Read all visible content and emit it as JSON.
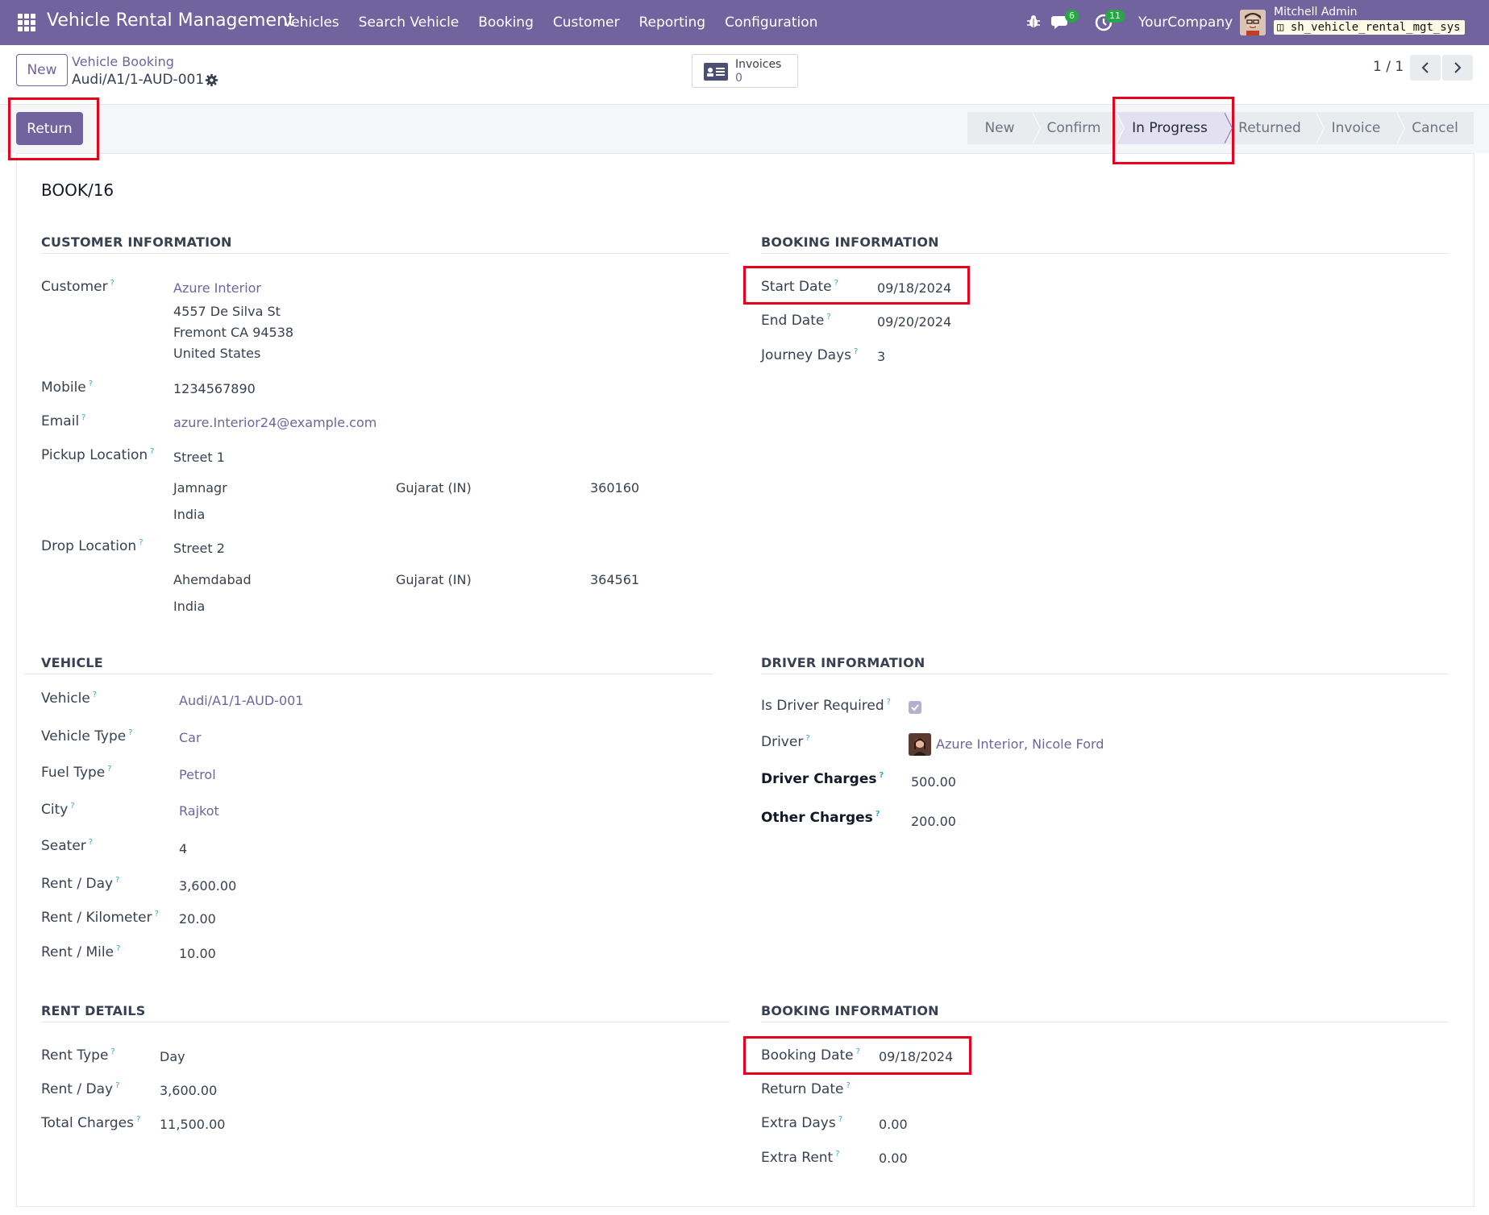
{
  "navbar": {
    "brand": "Vehicle Rental Management",
    "menu": [
      "Vehicles",
      "Search Vehicle",
      "Booking",
      "Customer",
      "Reporting",
      "Configuration"
    ],
    "chat_count": "6",
    "activity_count": "11",
    "company": "YourCompany",
    "user_name": "Mitchell Admin",
    "database": "sh_vehicle_rental_mgt_sys"
  },
  "control": {
    "new_label": "New",
    "breadcrumb_parent": "Vehicle Booking",
    "breadcrumb_current": "Audi/A1/1-AUD-001",
    "smart_invoices_label": "Invoices",
    "smart_invoices_count": "0",
    "pager": "1 / 1"
  },
  "statusbar": {
    "return_label": "Return",
    "stages": [
      "New",
      "Confirm",
      "In Progress",
      "Returned",
      "Invoice",
      "Cancel"
    ],
    "active_stage": "In Progress"
  },
  "record": {
    "reference": "BOOK/16"
  },
  "customer_info": {
    "title": "CUSTOMER INFORMATION",
    "customer_label": "Customer",
    "customer_name": "Azure Interior",
    "address_line1": "4557 De Silva St",
    "address_line2": "Fremont CA 94538",
    "address_line3": "United States",
    "mobile_label": "Mobile",
    "mobile": "1234567890",
    "email_label": "Email",
    "email": "azure.Interior24@example.com",
    "pickup_label": "Pickup Location",
    "pickup_street": "Street 1",
    "pickup_city": "Jamnagr",
    "pickup_state": "Gujarat (IN)",
    "pickup_zip": "360160",
    "pickup_country": "India",
    "drop_label": "Drop Location",
    "drop_street": "Street 2",
    "drop_city": "Ahemdabad",
    "drop_state": "Gujarat (IN)",
    "drop_zip": "364561",
    "drop_country": "India"
  },
  "booking_info": {
    "title": "BOOKING INFORMATION",
    "start_label": "Start Date",
    "start_date": "09/18/2024",
    "end_label": "End Date",
    "end_date": "09/20/2024",
    "days_label": "Journey Days",
    "days": "3"
  },
  "vehicle": {
    "title": "VEHICLE",
    "vehicle_label": "Vehicle",
    "vehicle": "Audi/A1/1-AUD-001",
    "type_label": "Vehicle Type",
    "type": "Car",
    "fuel_label": "Fuel Type",
    "fuel": "Petrol",
    "city_label": "City",
    "city": "Rajkot",
    "seater_label": "Seater",
    "seater": "4",
    "rent_day_label": "Rent / Day",
    "rent_day": "3,600.00",
    "rent_km_label": "Rent / Kilometer",
    "rent_km": "20.00",
    "rent_mile_label": "Rent / Mile",
    "rent_mile": "10.00"
  },
  "driver_info": {
    "title": "DRIVER INFORMATION",
    "required_label": "Is Driver Required",
    "driver_label": "Driver",
    "driver": "Azure Interior, Nicole Ford",
    "charges_label": "Driver Charges",
    "charges": "500.00",
    "other_label": "Other Charges",
    "other": "200.00"
  },
  "rent_details": {
    "title": "RENT DETAILS",
    "type_label": "Rent Type",
    "type": "Day",
    "rent_day_label": "Rent / Day",
    "rent_day": "3,600.00",
    "total_label": "Total Charges",
    "total": "11,500.00"
  },
  "booking_info2": {
    "title": "BOOKING INFORMATION",
    "booking_date_label": "Booking Date",
    "booking_date": "09/18/2024",
    "return_label": "Return Date",
    "extra_days_label": "Extra Days",
    "extra_days": "0.00",
    "extra_rent_label": "Extra Rent",
    "extra_rent": "0.00"
  },
  "colors": {
    "brand": "#71639e",
    "highlight": "#e8001c",
    "badge": "#28a745"
  }
}
